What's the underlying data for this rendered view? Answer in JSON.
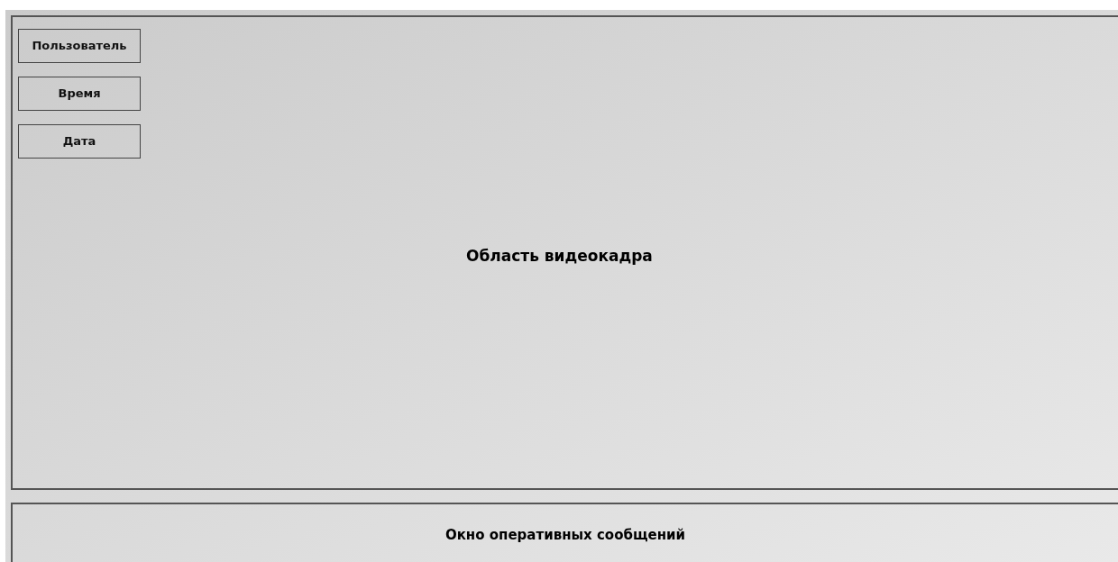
{
  "overlay_buttons": [
    {
      "label": "Пользователь"
    },
    {
      "label": "Время"
    },
    {
      "label": "Дата"
    }
  ],
  "video_area": {
    "label": "Область видеокадра"
  },
  "message_window": {
    "label": "Окно оперативных сообщений"
  }
}
